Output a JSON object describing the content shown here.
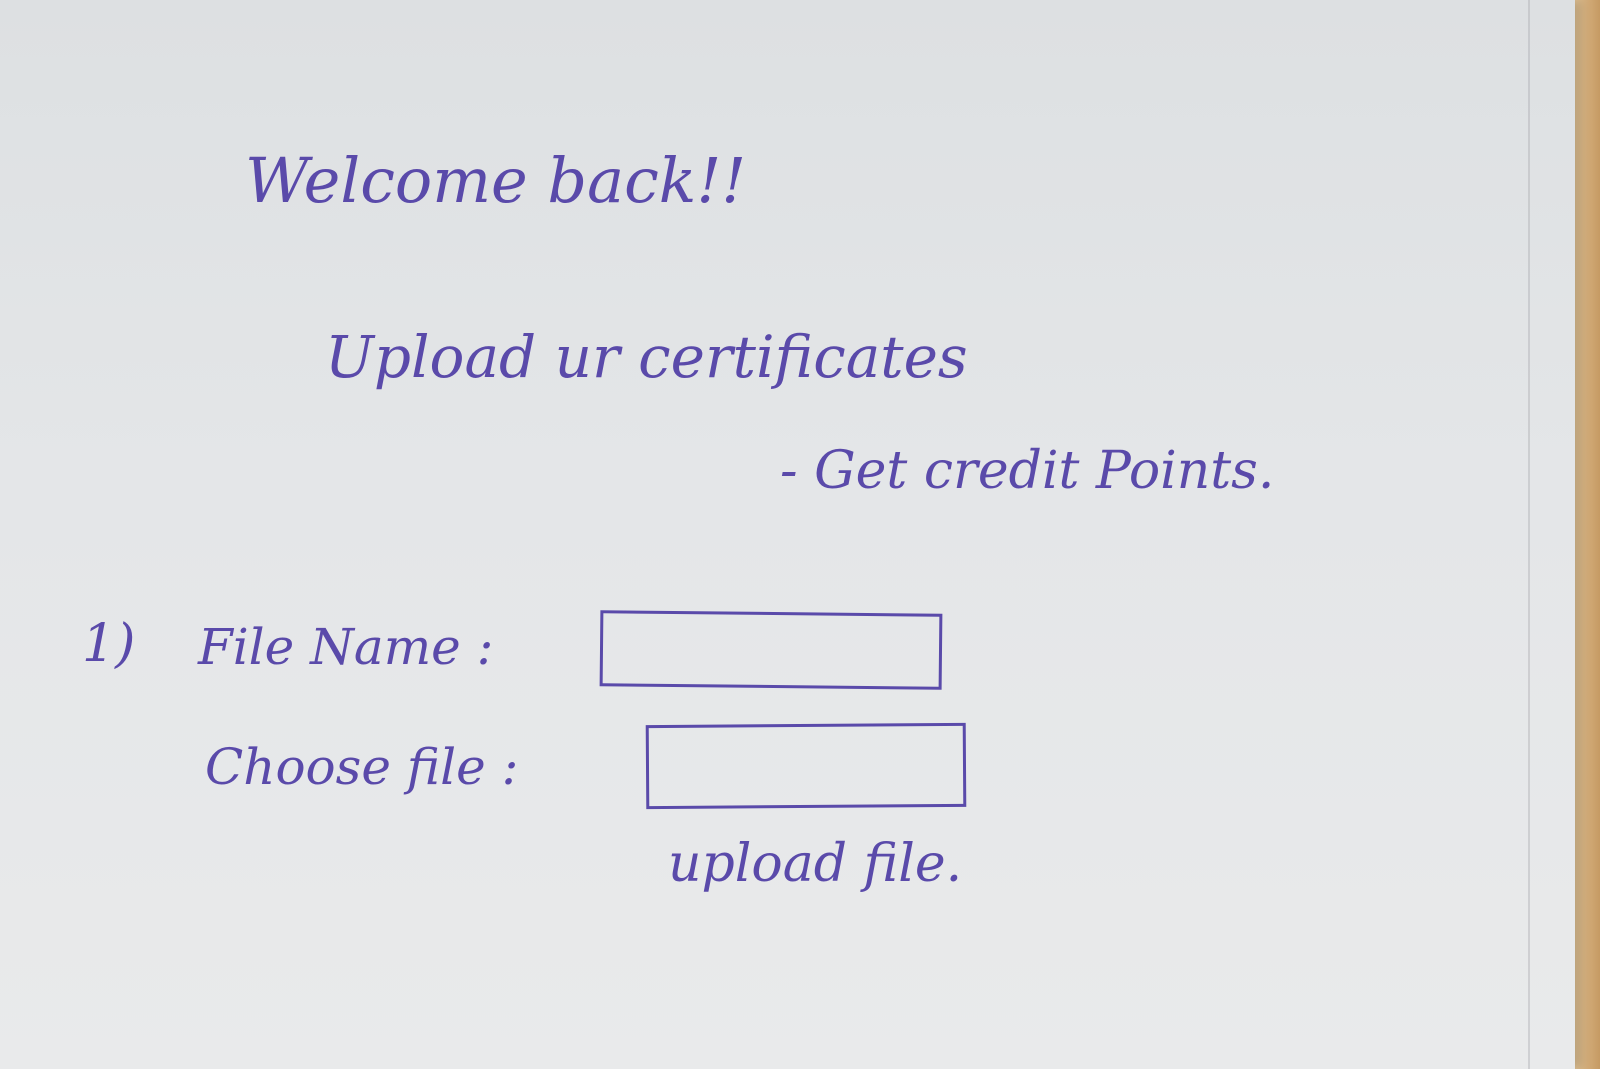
{
  "header": {
    "welcome": "Welcome back!!",
    "tagline": "Upload ur certificates",
    "subline": "- Get credit Points."
  },
  "form": {
    "item_number": "1)",
    "file_name_label": "File Name :",
    "choose_file_label": "Choose file :",
    "upload_label": "upload file."
  },
  "colors": {
    "ink": "#5a4aaa",
    "paper": "#e4e6e8"
  }
}
